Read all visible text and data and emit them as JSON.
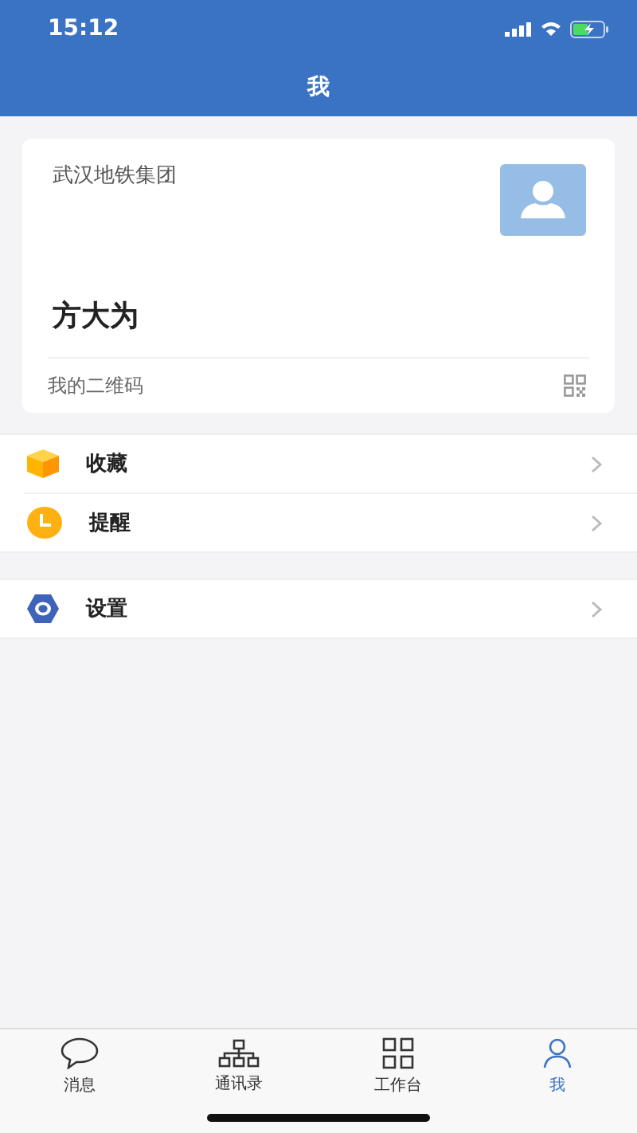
{
  "status_bar": {
    "time": "15:12"
  },
  "title": "我",
  "profile": {
    "organization": "武汉地铁集团",
    "name": "方大为",
    "qr_label": "我的二维码"
  },
  "menu_groups": [
    {
      "items": [
        {
          "label": "收藏",
          "kind": "box"
        },
        {
          "label": "提醒",
          "kind": "clock"
        }
      ]
    },
    {
      "items": [
        {
          "label": "设置",
          "kind": "gear"
        }
      ]
    }
  ],
  "tabs": [
    {
      "label": "消息",
      "kind": "chat",
      "selected": false
    },
    {
      "label": "通讯录",
      "kind": "org",
      "selected": false
    },
    {
      "label": "工作台",
      "kind": "grid",
      "selected": false
    },
    {
      "label": "我",
      "kind": "person",
      "selected": true
    }
  ]
}
